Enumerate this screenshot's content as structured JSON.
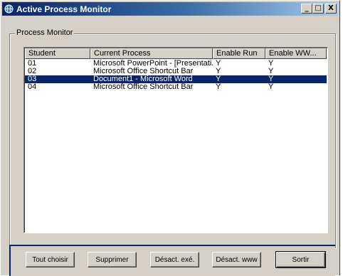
{
  "window": {
    "title": "Active Process Monitor",
    "controls": {
      "minimize": "_",
      "maximize": "□",
      "close": "X"
    }
  },
  "group": {
    "label": "Process Monitor"
  },
  "listview": {
    "columns": [
      "Student",
      "Current Process",
      "Enable Run",
      "Enable WW..."
    ],
    "rows": [
      {
        "student": "01",
        "process": "Microsoft PowerPoint - [Presentati...",
        "enable_run": "Y",
        "enable_www": "Y",
        "selected": false
      },
      {
        "student": "02",
        "process": "Microsoft Office Shortcut Bar",
        "enable_run": "Y",
        "enable_www": "Y",
        "selected": false
      },
      {
        "student": "03",
        "process": "Document1 - Microsoft Word",
        "enable_run": "Y",
        "enable_www": "Y",
        "selected": true
      },
      {
        "student": "04",
        "process": "Microsoft Office Shortcut Bar",
        "enable_run": "Y",
        "enable_www": "Y",
        "selected": false
      }
    ]
  },
  "buttons": {
    "select_all": "Tout choisir",
    "delete": "Supprimer",
    "disable_exe": "Désact. exé.",
    "disable_www": "Désact. www",
    "exit": "Sortir"
  },
  "colors": {
    "title_active": "#0a246a",
    "selection": "#0a246a",
    "face": "#d4d0c8"
  },
  "icons": {
    "app": "globe-icon"
  }
}
